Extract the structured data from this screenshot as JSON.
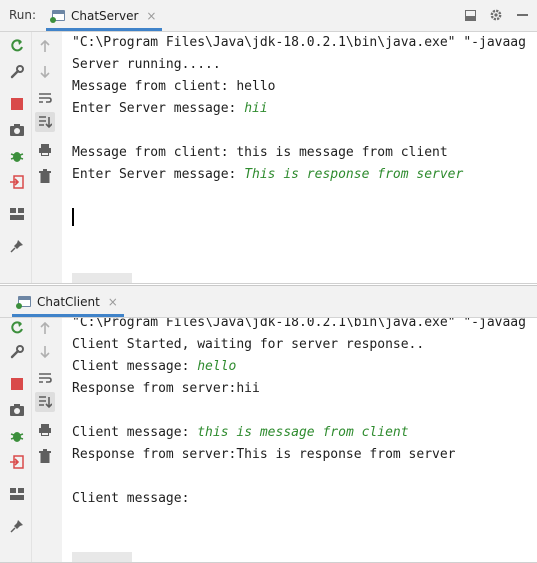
{
  "run_label": "Run:",
  "panes": [
    {
      "tab": "ChatServer",
      "tab_close": "×",
      "lines": [
        {
          "text": "\"C:\\Program Files\\Java\\jdk-18.0.2.1\\bin\\java.exe\" \"-javaag",
          "input": ""
        },
        {
          "text": "Server running.....",
          "input": ""
        },
        {
          "text": "Message from client: hello",
          "input": ""
        },
        {
          "text": "Enter Server message: ",
          "input": "hii"
        },
        {
          "text": "",
          "input": ""
        },
        {
          "text": "Message from client: this is message from client",
          "input": ""
        },
        {
          "text": "Enter Server message: ",
          "input": "This is response from server"
        }
      ]
    },
    {
      "tab": "ChatClient",
      "tab_close": "×",
      "lines": [
        {
          "text": "\"C:\\Program Files\\Java\\jdk-18.0.2.1\\bin\\java.exe\" \"-javaag",
          "input": ""
        },
        {
          "text": "Client Started, waiting for server response..",
          "input": ""
        },
        {
          "text": "Client message: ",
          "input": "hello"
        },
        {
          "text": "Response from server:hii",
          "input": ""
        },
        {
          "text": "",
          "input": ""
        },
        {
          "text": "Client message: ",
          "input": "this is message from client"
        },
        {
          "text": "Response from server:This is response from server",
          "input": ""
        },
        {
          "text": "",
          "input": ""
        },
        {
          "text": "Client message:",
          "input": ""
        }
      ]
    }
  ],
  "colors": {
    "user_input": "#2e8b2e",
    "tab_underline": "#4083c9",
    "rerun": "#3c8f3c",
    "stop": "#d94a4a"
  },
  "icons": {
    "top_right": [
      "hide-panel-icon",
      "gear-icon",
      "minimize-icon"
    ],
    "toolbar_left": [
      "rerun-icon",
      "wrench-icon",
      "stop-icon",
      "camera-icon",
      "debug-bug-icon",
      "exit-icon",
      "layout-icon",
      "pin-icon"
    ],
    "toolbar_right": [
      "up-arrow-icon",
      "down-arrow-icon",
      "soft-wrap-icon",
      "scroll-to-end-icon",
      "print-icon",
      "trash-icon"
    ]
  }
}
